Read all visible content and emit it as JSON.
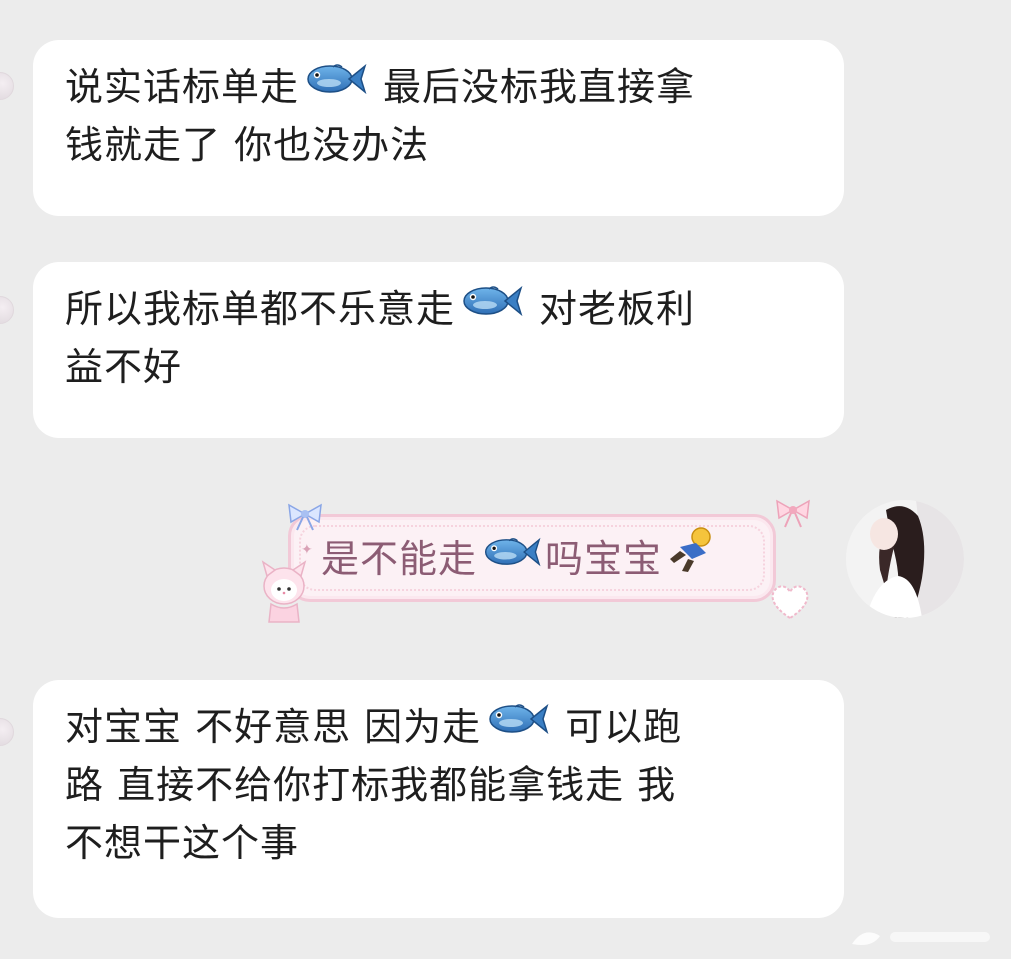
{
  "messages": [
    {
      "side": "left",
      "before": "说实话标单走",
      "after_line1": "最后没标我直接拿",
      "line2": "钱就走了 你也没办法"
    },
    {
      "side": "left",
      "before": "所以我标单都不乐意走",
      "after_line1": "对老板利",
      "line2": "益不好"
    },
    {
      "side": "right",
      "before": "是不能走",
      "after": "吗宝宝"
    },
    {
      "side": "left",
      "line1_a": "对宝宝 不好意思 因为走",
      "line1_b": "可以跑",
      "line2": "路 直接不给你打标我都能拿钱走 我",
      "line3": "不想干这个事"
    }
  ],
  "icons": {
    "emoji": "fish-emoji",
    "sticker": "running-person-emoji"
  },
  "colors": {
    "background": "#ececec",
    "bubble": "#ffffff",
    "pink_bubble_bg": "#fcf1f5",
    "pink_border": "#f2c9d7",
    "pink_text": "#8c5c74"
  }
}
